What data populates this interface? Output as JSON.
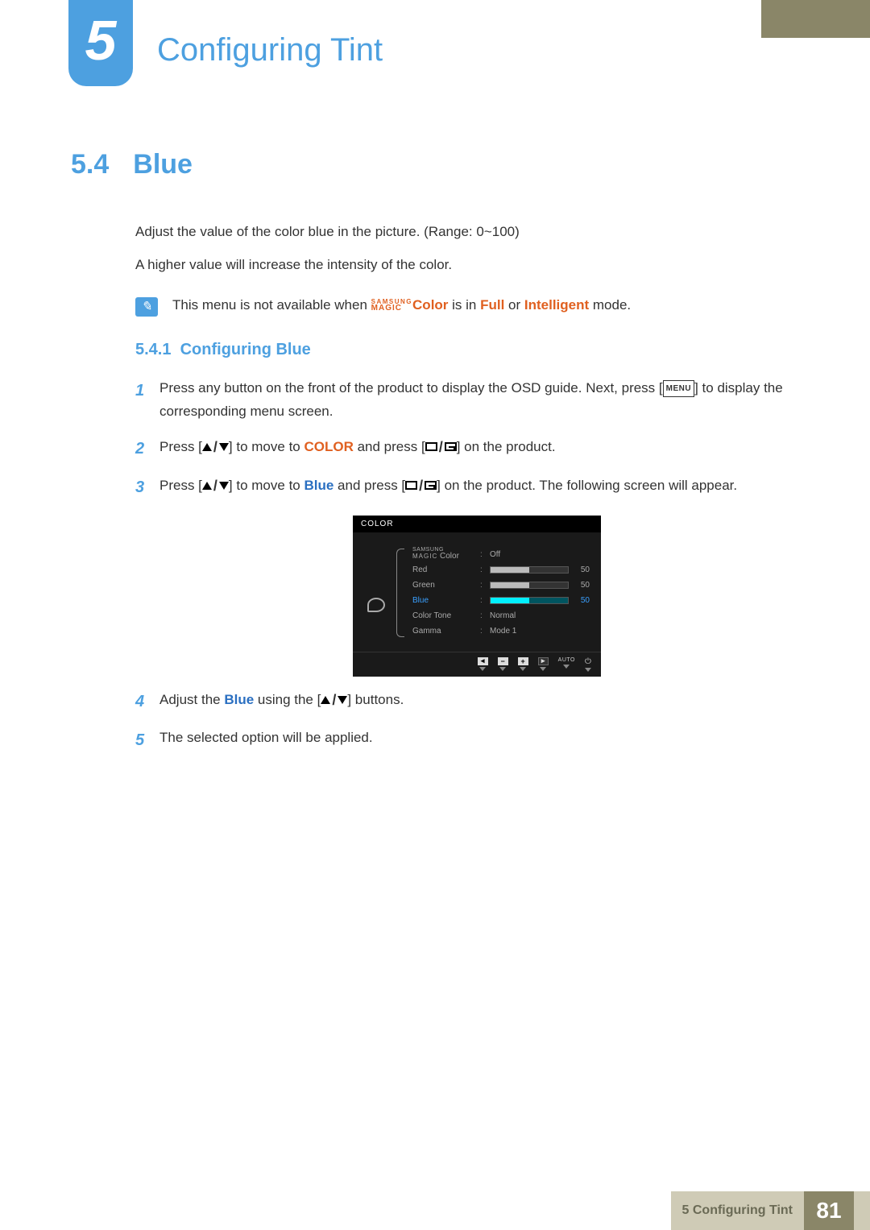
{
  "chapter": {
    "number": "5",
    "title": "Configuring Tint"
  },
  "section": {
    "number": "5.4",
    "title": "Blue"
  },
  "intro": {
    "line1": "Adjust the value of the color blue in the picture. (Range: 0~100)",
    "line2": "A higher value will increase the intensity of the color."
  },
  "note": {
    "pre": "This menu is not available when ",
    "brand_top": "SAMSUNG",
    "brand_bot": "MAGIC",
    "color_word": "Color",
    "mid": " is in ",
    "full": "Full",
    "or": " or ",
    "intelligent": "Intelligent",
    "post": " mode."
  },
  "subsection": {
    "number": "5.4.1",
    "title": "Configuring Blue"
  },
  "steps": {
    "s1a": "Press any button on the front of the product to display the OSD guide. Next, press [",
    "s1_menu": "MENU",
    "s1b": "] to display the corresponding menu screen.",
    "s2a": "Press [",
    "s2b": "] to move to ",
    "s2_color": "COLOR",
    "s2c": " and press [",
    "s2d": "] on the product.",
    "s3a": "Press [",
    "s3b": "] to move to ",
    "s3_blue": "Blue",
    "s3c": " and press [",
    "s3d": "] on the product. The following screen will appear.",
    "s4a": "Adjust the ",
    "s4_blue": "Blue",
    "s4b": " using the [",
    "s4c": "] buttons.",
    "s5": "The selected option will be applied."
  },
  "step_numbers": {
    "n1": "1",
    "n2": "2",
    "n3": "3",
    "n4": "4",
    "n5": "5"
  },
  "osd": {
    "title": "COLOR",
    "rows": {
      "magic": {
        "brand_top": "SAMSUNG",
        "brand_bot": "MAGIC",
        "suffix": " Color",
        "value": "Off"
      },
      "red": {
        "label": "Red",
        "value": 50,
        "fill": 50
      },
      "green": {
        "label": "Green",
        "value": 50,
        "fill": 50
      },
      "blue": {
        "label": "Blue",
        "value": 50,
        "fill": 50
      },
      "tone": {
        "label": "Color Tone",
        "value": "Normal"
      },
      "gamma": {
        "label": "Gamma",
        "value": "Mode 1"
      }
    },
    "footer": {
      "auto": "AUTO"
    }
  },
  "footer": {
    "label_num": "5",
    "label_text": "Configuring Tint",
    "page": "81"
  }
}
